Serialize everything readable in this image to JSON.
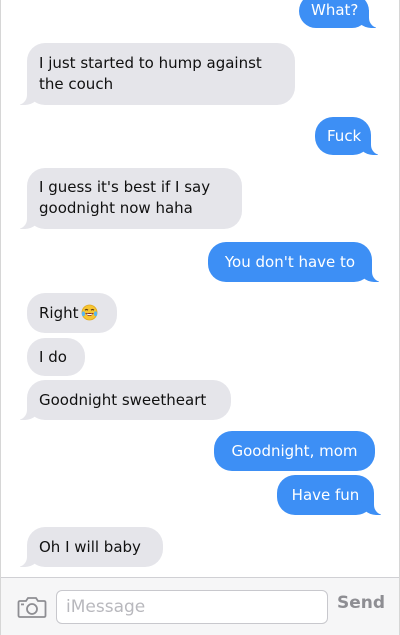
{
  "messages": [
    {
      "direction": "out",
      "text": "What?"
    },
    {
      "direction": "in",
      "lines": [
        "I just started to hump against",
        "the couch"
      ]
    },
    {
      "direction": "out",
      "text": "Fuck"
    },
    {
      "direction": "in",
      "lines": [
        "I guess it's best if I say",
        "goodnight now haha"
      ]
    },
    {
      "direction": "out",
      "text": "You don't have to"
    },
    {
      "direction": "in",
      "text": "Right",
      "emoji": "tears-of-joy-emoji"
    },
    {
      "direction": "in",
      "text": "I do"
    },
    {
      "direction": "in",
      "text": "Goodnight sweetheart"
    },
    {
      "direction": "out",
      "text": "Goodnight, mom"
    },
    {
      "direction": "out",
      "text": "Have fun"
    },
    {
      "direction": "in",
      "text": "Oh I will baby"
    }
  ],
  "composer": {
    "placeholder": "iMessage",
    "send_label": "Send",
    "camera_icon": "camera-icon"
  },
  "colors": {
    "incoming_bubble": "#e5e5ea",
    "outgoing_bubble": "#3d8ff5",
    "send_text": "#8e8e93"
  }
}
